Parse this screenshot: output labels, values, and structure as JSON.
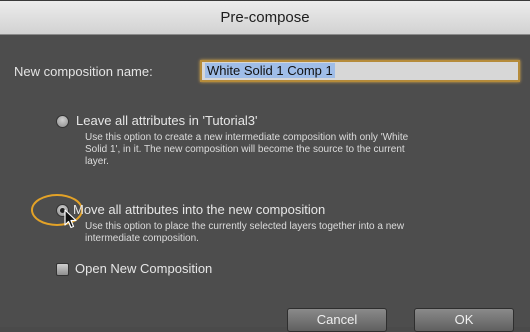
{
  "dialog": {
    "title": "Pre-compose",
    "name_label": "New composition name:",
    "name_value": "White Solid 1 Comp 1",
    "option1": {
      "label": "Leave all attributes in 'Tutorial3'",
      "description_line1": "Use this option to create a new intermediate composition with only 'White",
      "description_line2": "Solid 1', in it. The new composition will become the source to the current",
      "description_line3": "layer.",
      "selected": false
    },
    "option2": {
      "label": "Move all attributes into the new composition",
      "description_line1": "Use this option to place the currently selected layers together into a new",
      "description_line2": "intermediate composition.",
      "selected": true
    },
    "open_checkbox": {
      "label": "Open New Composition",
      "checked": false
    },
    "buttons": {
      "cancel": "Cancel",
      "ok": "OK"
    }
  },
  "colors": {
    "highlight_ring": "#e3a227",
    "input_focus": "#b58b3a",
    "text_selection": "#9fbde8"
  }
}
